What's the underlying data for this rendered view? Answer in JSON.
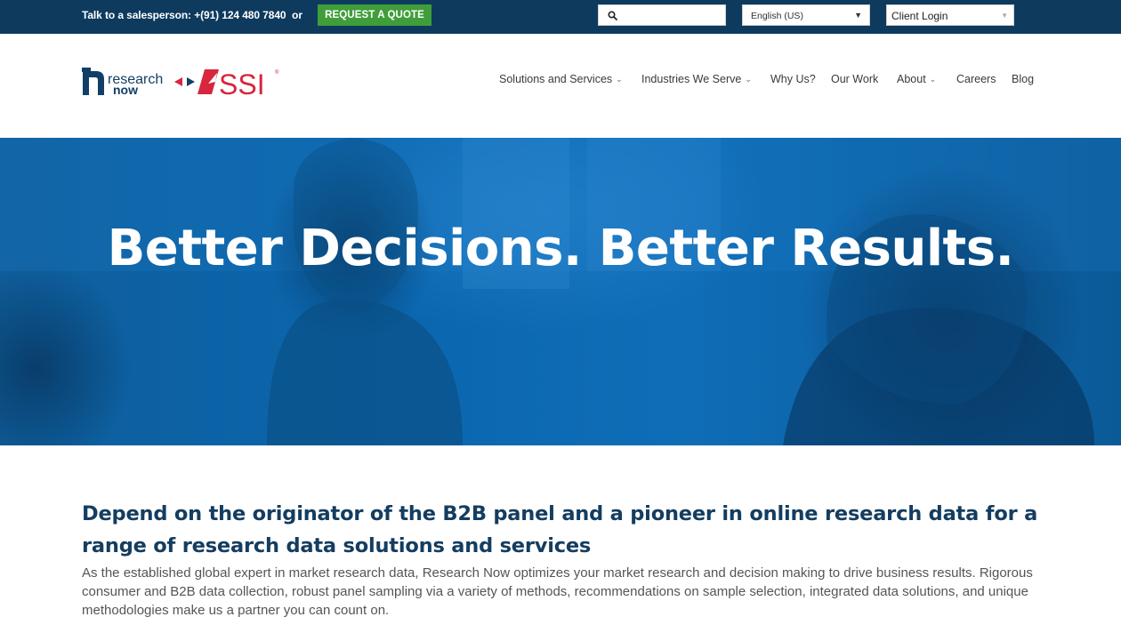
{
  "topbar": {
    "talk_text": "Talk to a salesperson: +(91) 124 480 7840",
    "or_text": "or",
    "quote_button": "REQUEST A QUOTE",
    "search_placeholder": "",
    "language": "English (US)",
    "client_login": "Client Login"
  },
  "logo": {
    "research_now_line1": "research",
    "research_now_line2": "now",
    "ssi_text": "SSI"
  },
  "nav": {
    "items": [
      {
        "label": "Solutions and Services",
        "dropdown": true
      },
      {
        "label": "Industries We Serve",
        "dropdown": true
      },
      {
        "label": "Why Us?",
        "dropdown": false
      },
      {
        "label": "Our Work",
        "dropdown": false
      },
      {
        "label": "About",
        "dropdown": true
      },
      {
        "label": "Careers",
        "dropdown": false
      },
      {
        "label": "Blog",
        "dropdown": false
      }
    ]
  },
  "hero": {
    "title": "Better Decisions. Better Results."
  },
  "content": {
    "heading": "Depend on the originator of the B2B panel and a pioneer in online research data for a range of research data solutions and services",
    "paragraph": "As the established global expert in market research data, Research Now optimizes your market research and decision making to drive business results. Rigorous consumer and B2B data collection, robust panel sampling via a variety of methods, recommendations on sample selection, integrated data solutions, and unique methodologies make us a partner you can count on."
  },
  "colors": {
    "topbar_bg": "#0e3a5e",
    "quote_green": "#3f9e3a",
    "hero_blue": "#0a66ae",
    "heading_navy": "#143d60",
    "ssi_red": "#d7263d"
  }
}
